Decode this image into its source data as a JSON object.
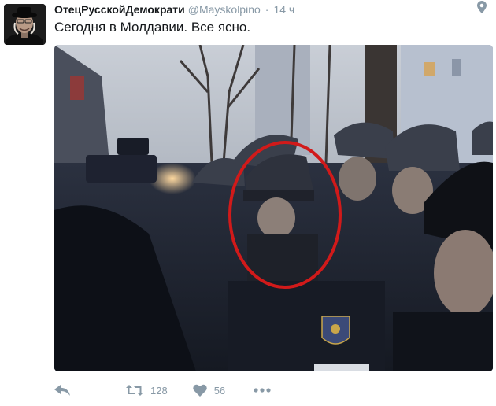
{
  "tweet": {
    "author_name": "ОтецРусскойДемократи",
    "author_handle": "@Mayskolpino",
    "separator": "·",
    "time": "14 ч",
    "text": "Сегодня в Молдавии. Все ясно."
  },
  "actions": {
    "retweet_count": "128",
    "like_count": "56"
  },
  "icons": {
    "reply": "reply-icon",
    "retweet": "retweet-icon",
    "like": "heart-icon",
    "more": "more-icon",
    "location": "location-pin-icon"
  },
  "colors": {
    "text": "#14171a",
    "muted": "#8899a6",
    "highlight_circle": "#d11a1a"
  }
}
